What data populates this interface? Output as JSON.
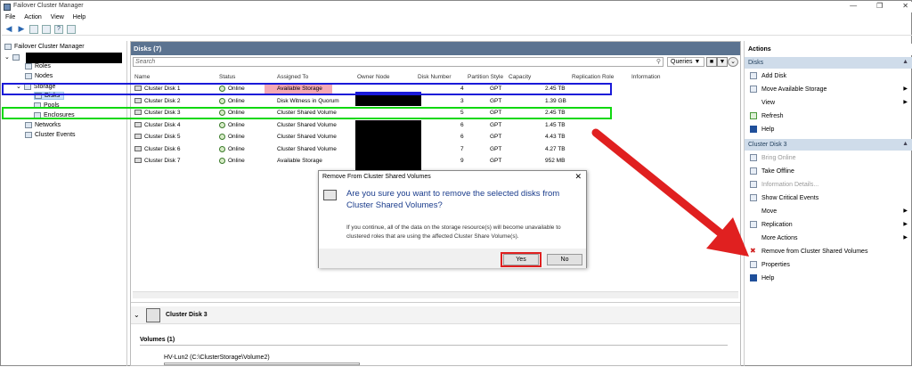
{
  "window": {
    "title": "Failover Cluster Manager"
  },
  "menu": [
    "File",
    "Action",
    "View",
    "Help"
  ],
  "tree": {
    "root": "Failover Cluster Manager",
    "items": [
      "Roles",
      "Nodes",
      "Storage",
      "Disks",
      "Pools",
      "Enclosures",
      "Networks",
      "Cluster Events"
    ]
  },
  "disks_pane": {
    "title": "Disks (7)",
    "search_placeholder": "Search",
    "queries_label": "Queries",
    "columns": [
      "Name",
      "Status",
      "Assigned To",
      "Owner Node",
      "Disk Number",
      "Partition Style",
      "Capacity",
      "Replication Role",
      "Information"
    ],
    "rows": [
      {
        "name": "Cluster Disk 1",
        "status": "Online",
        "assigned": "Available Storage",
        "disk": "4",
        "style": "GPT",
        "capacity": "2.45 TB"
      },
      {
        "name": "Cluster Disk 2",
        "status": "Online",
        "assigned": "Disk Witness in Quorum",
        "disk": "3",
        "style": "GPT",
        "capacity": "1.39 GB"
      },
      {
        "name": "Cluster Disk 3",
        "status": "Online",
        "assigned": "Cluster Shared Volume",
        "disk": "5",
        "style": "GPT",
        "capacity": "2.45 TB"
      },
      {
        "name": "Cluster Disk 4",
        "status": "Online",
        "assigned": "Cluster Shared Volume",
        "disk": "6",
        "style": "GPT",
        "capacity": "1.45 TB"
      },
      {
        "name": "Cluster Disk 5",
        "status": "Online",
        "assigned": "Cluster Shared Volume",
        "disk": "6",
        "style": "GPT",
        "capacity": "4.43 TB"
      },
      {
        "name": "Cluster Disk 6",
        "status": "Online",
        "assigned": "Cluster Shared Volume",
        "disk": "7",
        "style": "GPT",
        "capacity": "4.27 TB"
      },
      {
        "name": "Cluster Disk 7",
        "status": "Online",
        "assigned": "Available Storage",
        "disk": "9",
        "style": "GPT",
        "capacity": "952 MB"
      }
    ]
  },
  "detail": {
    "title": "Cluster Disk 3",
    "volumes_label": "Volumes (1)",
    "volume_name": "HV-Lun2 (C:\\ClusterStorage\\Volume2)"
  },
  "dialog": {
    "title": "Remove From Cluster Shared Volumes",
    "question": "Are you sure you want to remove the selected disks from Cluster Shared Volumes?",
    "body": "If you continue, all of the data on the storage resource(s) will become unavailable to clustered roles that are using the affected Cluster Share Volume(s).",
    "yes": "Yes",
    "no": "No"
  },
  "actions": {
    "title": "Actions",
    "disks_section": "Disks",
    "disks_items": [
      "Add Disk",
      "Move Available Storage",
      "View",
      "Refresh",
      "Help"
    ],
    "disk3_section": "Cluster Disk 3",
    "disk3_items": [
      "Bring Online",
      "Take Offline",
      "Information Details...",
      "Show Critical Events",
      "Move",
      "Replication",
      "More Actions",
      "Remove from Cluster Shared Volumes",
      "Properties",
      "Help"
    ]
  },
  "colors": {
    "highlight_blue": "#1a1ad8",
    "highlight_green": "#10d810",
    "annotation_red": "#e02020"
  }
}
